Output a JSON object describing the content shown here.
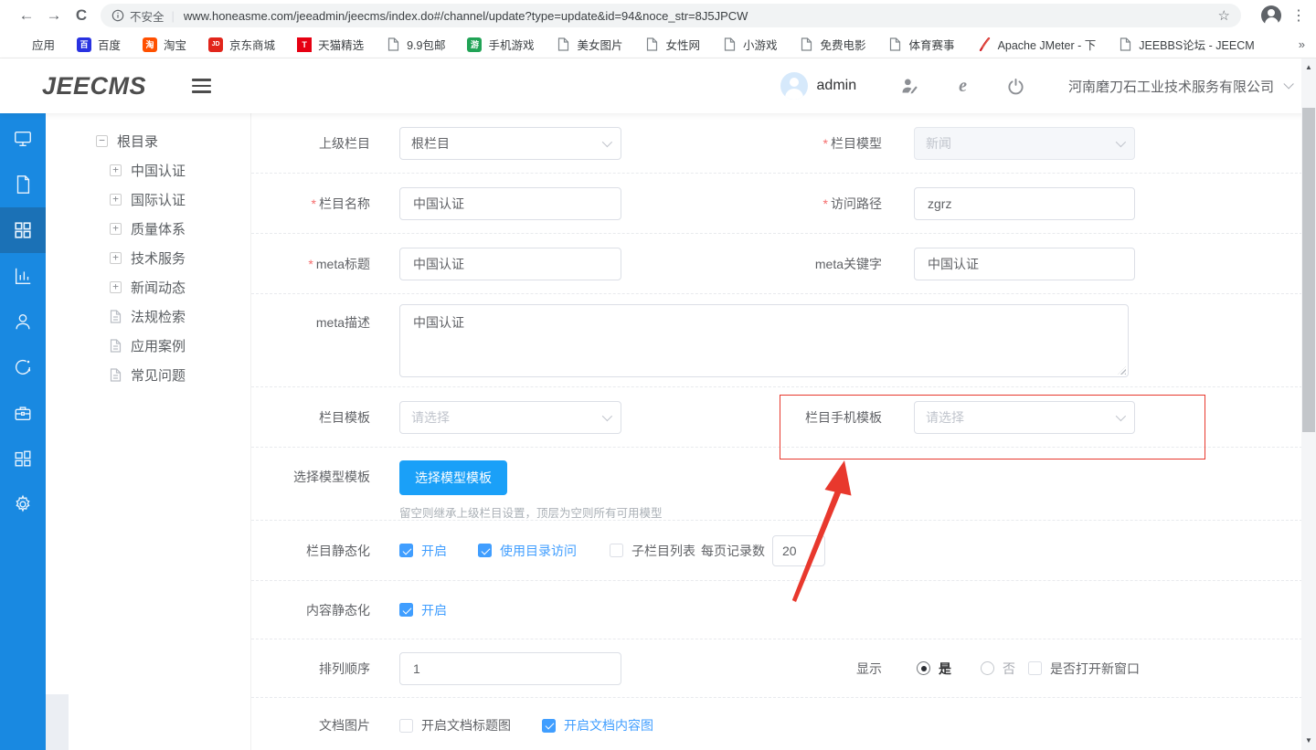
{
  "colors": {
    "accent": "#409eff",
    "sidebar_blue": "#1989e1",
    "button_blue": "#1aa0f8",
    "annotation_red": "#e8382d"
  },
  "browser": {
    "security_label": "不安全",
    "url": "www.honeasme.com/jeeadmin/jeecms/index.do#/channel/update?type=update&id=94&noce_str=8J5JPCW",
    "bookmarks_overflow": "»",
    "bookmarks": [
      {
        "label": "应用",
        "icon": "apps-grid"
      },
      {
        "label": "百度",
        "icon": "baidu",
        "glyph": "百",
        "color": "#2932e1"
      },
      {
        "label": "淘宝",
        "icon": "taobao",
        "glyph": "淘",
        "color": "#ff5000"
      },
      {
        "label": "京东商城",
        "icon": "jd",
        "glyph": "JD",
        "color": "#e1251b"
      },
      {
        "label": "天猫精选",
        "icon": "tmall",
        "glyph": "T",
        "color": "#e60012"
      },
      {
        "label": "9.9包邮",
        "icon": "page"
      },
      {
        "label": "手机游戏",
        "icon": "game",
        "glyph": "游",
        "color": "#21a356"
      },
      {
        "label": "美女图片",
        "icon": "page"
      },
      {
        "label": "女性网",
        "icon": "page"
      },
      {
        "label": "小游戏",
        "icon": "page"
      },
      {
        "label": "免费电影",
        "icon": "page"
      },
      {
        "label": "体育赛事",
        "icon": "page"
      },
      {
        "label": "Apache JMeter - 下",
        "icon": "jmeter-feather",
        "color": "#d22128"
      },
      {
        "label": "JEEBBS论坛 - JEECM",
        "icon": "page"
      }
    ]
  },
  "header": {
    "logo": "JEECMS",
    "username": "admin",
    "company": "河南磨刀石工业技术服务有限公司"
  },
  "sidebar": {
    "active_index": 2,
    "items": [
      "monitor",
      "document",
      "channel-grid",
      "bar-chart",
      "user",
      "sync",
      "toolbox",
      "layout",
      "gear"
    ]
  },
  "tree": {
    "items": [
      {
        "label": "根目录",
        "toggle": "−",
        "expanded": true
      },
      {
        "label": "中国认证",
        "toggle": "+"
      },
      {
        "label": "国际认证",
        "toggle": "+"
      },
      {
        "label": "质量体系",
        "toggle": "+"
      },
      {
        "label": "技术服务",
        "toggle": "+"
      },
      {
        "label": "新闻动态",
        "toggle": "+"
      },
      {
        "label": "法规检索",
        "toggle": "leaf"
      },
      {
        "label": "应用案例",
        "toggle": "leaf"
      },
      {
        "label": "常见问题",
        "toggle": "leaf"
      }
    ]
  },
  "form": {
    "required_mark": "*",
    "parent_channel": {
      "label": "上级栏目",
      "value": "根栏目"
    },
    "channel_model": {
      "label": "栏目模型",
      "value": "新闻",
      "required": true,
      "disabled": true
    },
    "channel_name": {
      "label": "栏目名称",
      "value": "中国认证",
      "required": true
    },
    "access_path": {
      "label": "访问路径",
      "value": "zgrz",
      "required": true
    },
    "meta_title": {
      "label": "meta标题",
      "value": "中国认证",
      "required": true
    },
    "meta_keywords": {
      "label": "meta关键字",
      "value": "中国认证"
    },
    "meta_description": {
      "label": "meta描述",
      "value": "中国认证"
    },
    "channel_template": {
      "label": "栏目模板",
      "placeholder": "请选择"
    },
    "mobile_template": {
      "label": "栏目手机模板",
      "placeholder": "请选择",
      "annotated": true
    },
    "model_template": {
      "label": "选择模型模板",
      "button": "选择模型模板",
      "hint": "留空则继承上级栏目设置，顶层为空则所有可用模型"
    },
    "channel_static": {
      "label": "栏目静态化",
      "opt_enable": "开启",
      "opt_enable_checked": true,
      "opt_dir": "使用目录访问",
      "opt_dir_checked": true,
      "opt_sub": "子栏目列表",
      "opt_sub_checked": false,
      "per_page_label": "每页记录数",
      "per_page_value": "20"
    },
    "content_static": {
      "label": "内容静态化",
      "opt_enable": "开启",
      "opt_enable_checked": true
    },
    "order": {
      "label": "排列顺序",
      "value": "1"
    },
    "display": {
      "label": "显示",
      "yes": "是",
      "no": "否",
      "selected": "yes",
      "new_window": "是否打开新窗口",
      "new_window_checked": false
    },
    "doc_image": {
      "label": "文档图片",
      "opt_title": "开启文档标题图",
      "opt_title_checked": false,
      "opt_content": "开启文档内容图",
      "opt_content_checked": true
    }
  }
}
